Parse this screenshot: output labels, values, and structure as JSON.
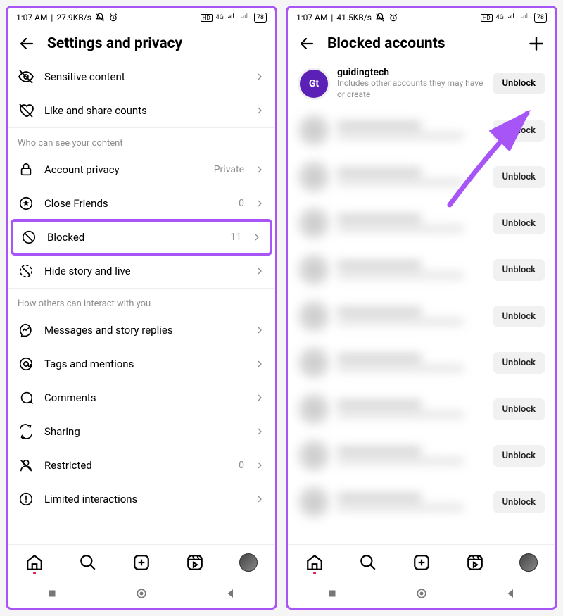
{
  "left": {
    "status": {
      "time": "1:07 AM",
      "net": "27.9KB/s",
      "sig": "4G",
      "battery": "78"
    },
    "title": "Settings and privacy",
    "rows": {
      "sensitive": "Sensitive content",
      "likeshare": "Like and share counts",
      "section1": "Who can see your content",
      "privacy_label": "Account privacy",
      "privacy_value": "Private",
      "close_label": "Close Friends",
      "close_value": "0",
      "blocked_label": "Blocked",
      "blocked_value": "11",
      "hide": "Hide story and live",
      "section2": "How others can interact with you",
      "msg": "Messages and story replies",
      "tags": "Tags and mentions",
      "comments": "Comments",
      "sharing": "Sharing",
      "restricted_label": "Restricted",
      "restricted_value": "0",
      "limited": "Limited interactions"
    }
  },
  "right": {
    "status": {
      "time": "1:07 AM",
      "net": "41.5KB/s",
      "sig": "4G",
      "battery": "78"
    },
    "title": "Blocked accounts",
    "first_account": {
      "username": "guidingtech",
      "desc": "Includes other accounts they may have or create",
      "badge": "Gt"
    },
    "unblock_label": "Unblock",
    "blurred_count": 9
  }
}
